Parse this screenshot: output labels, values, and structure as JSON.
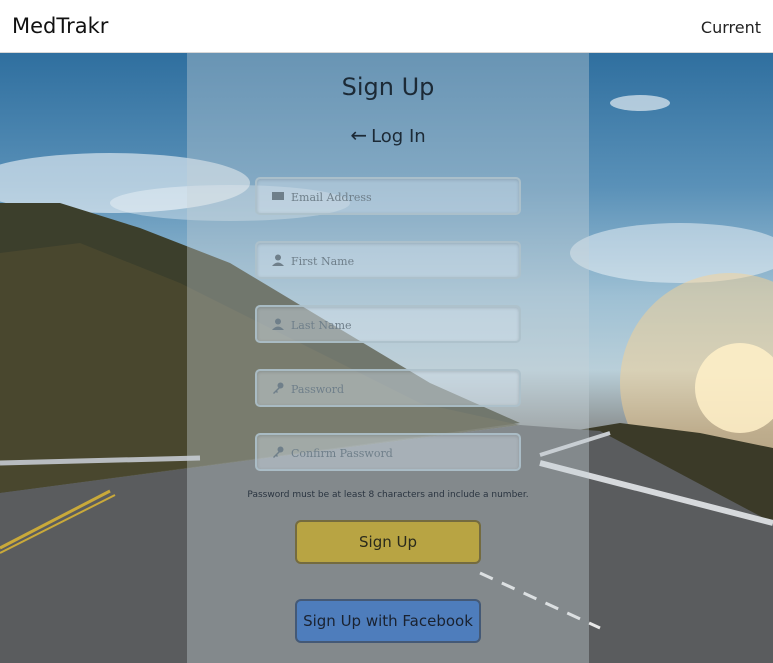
{
  "navbar": {
    "brand": "MedTrakr",
    "link": "Current"
  },
  "form": {
    "title": "Sign Up",
    "login_label": "Log In",
    "fields": [
      {
        "placeholder": "Email Address",
        "icon": "envelope-icon"
      },
      {
        "placeholder": "First Name",
        "icon": "user-icon"
      },
      {
        "placeholder": "Last Name",
        "icon": "user-icon"
      },
      {
        "placeholder": "Password",
        "icon": "key-icon"
      },
      {
        "placeholder": "Confirm Password",
        "icon": "key-icon"
      }
    ],
    "hint": "Password must be at least 8 characters and include a number.",
    "signup_label": "Sign Up",
    "facebook_label": "Sign Up with Facebook"
  },
  "colors": {
    "signup_button": "#b8a443",
    "facebook_button": "#4e7dbc"
  }
}
